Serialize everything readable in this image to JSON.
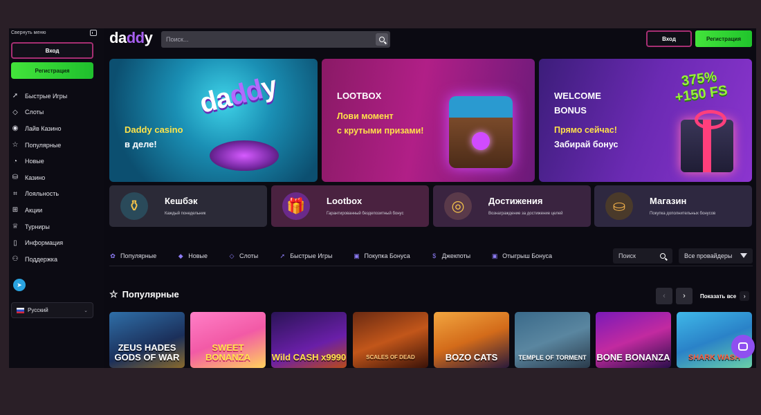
{
  "sidebar": {
    "collapse_label": "Свернуть меню",
    "login_label": "Вход",
    "register_label": "Регистрация",
    "items": [
      {
        "label": "Быстрые Игры",
        "icon": "rocket-icon"
      },
      {
        "label": "Слоты",
        "icon": "diamond-icon"
      },
      {
        "label": "Лайв Казино",
        "icon": "live-icon"
      },
      {
        "label": "Популярные",
        "icon": "star-icon"
      },
      {
        "label": "Новые",
        "icon": "new-icon"
      },
      {
        "label": "Казино",
        "icon": "chips-icon"
      },
      {
        "label": "Лояльность",
        "icon": "loyalty-icon"
      },
      {
        "label": "Акции",
        "icon": "gift-icon"
      },
      {
        "label": "Турниры",
        "icon": "trophy-icon"
      },
      {
        "label": "Информация",
        "icon": "document-icon"
      },
      {
        "label": "Поддержка",
        "icon": "support-icon"
      }
    ],
    "language": "Русский"
  },
  "header": {
    "logo": "daddy",
    "search_placeholder": "Поиск...",
    "login_label": "Вход",
    "register_label": "Регистрация"
  },
  "banners": [
    {
      "line1": "Daddy casino",
      "line2": "в деле!",
      "logo": "daddy"
    },
    {
      "title": "LOOTBOX",
      "line1": "Лови момент",
      "line2": "с крутыми призами!"
    },
    {
      "title1": "WELCOME",
      "title2": "BONUS",
      "line1": "Прямо сейчас!",
      "line2": "Забирай бонус",
      "badge1": "375%",
      "badge2": "+150 FS"
    }
  ],
  "promos": [
    {
      "title": "Кешбэк",
      "subtitle": "Каждый понедельник"
    },
    {
      "title": "Lootbox",
      "subtitle": "Гарантированный бездепозитный бонус"
    },
    {
      "title": "Достижения",
      "subtitle": "Вознаграждение за достижение целей"
    },
    {
      "title": "Магазин",
      "subtitle": "Покупка дополнительных бонусов"
    }
  ],
  "filters": {
    "items": [
      {
        "label": "Популярные",
        "icon": "popular-icon"
      },
      {
        "label": "Новые",
        "icon": "drop-icon"
      },
      {
        "label": "Слоты",
        "icon": "diamond-icon"
      },
      {
        "label": "Быстрые Игры",
        "icon": "rocket-icon"
      },
      {
        "label": "Покупка Бонуса",
        "icon": "bag-icon"
      },
      {
        "label": "Джекпоты",
        "icon": "coin-icon"
      },
      {
        "label": "Отыгрыш Бонуса",
        "icon": "bag-icon"
      }
    ],
    "search_label": "Поиск",
    "providers_label": "Все провайдеры"
  },
  "popular": {
    "title": "Популярные",
    "show_all": "Показать все",
    "games": [
      {
        "title": "ZEUS HADES GODS OF WAR"
      },
      {
        "title": "SWEET BONANZA"
      },
      {
        "title": "Wild CASH x9990"
      },
      {
        "title": "SCALES OF DEAD"
      },
      {
        "title": "BOZO CATS"
      },
      {
        "title": "TEMPLE OF TORMENT"
      },
      {
        "title": "BONE BONANZA"
      },
      {
        "title": "SHARK WASH"
      }
    ]
  }
}
